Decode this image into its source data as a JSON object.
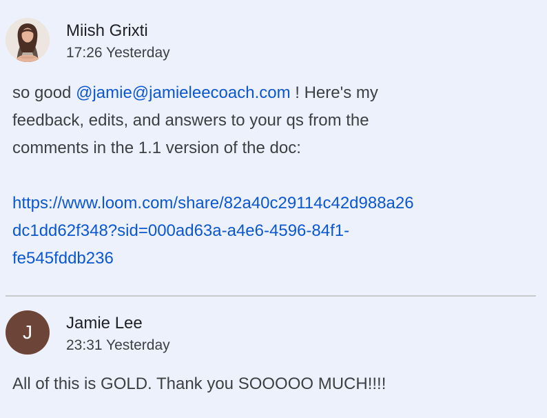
{
  "comments": [
    {
      "author": "Miish Grixti",
      "timestamp": "17:26 Yesterday",
      "text_before_mention": "so good ",
      "mention": "@jamie@jamieleecoach.com",
      "text_after_mention_line1": " ! Here's my",
      "text_line2": "feedback, edits, and answers to your qs from the",
      "text_line3": "comments in the 1.1 version of the doc:",
      "link_line1": "https://www.loom.com/share/82a40c29114c42d988a26",
      "link_line2": "dc1dd62f348?sid=000ad63a-a4e6-4596-84f1-",
      "link_line3": "fe545fddb236"
    },
    {
      "author": "Jamie Lee",
      "avatar_initial": "J",
      "timestamp": "23:31 Yesterday",
      "text": "All of this is GOLD. Thank you SOOOOO MUCH!!!!"
    }
  ],
  "colors": {
    "background": "#edf1fb",
    "link": "#0b57d0",
    "avatar_j": "#6d4438"
  }
}
